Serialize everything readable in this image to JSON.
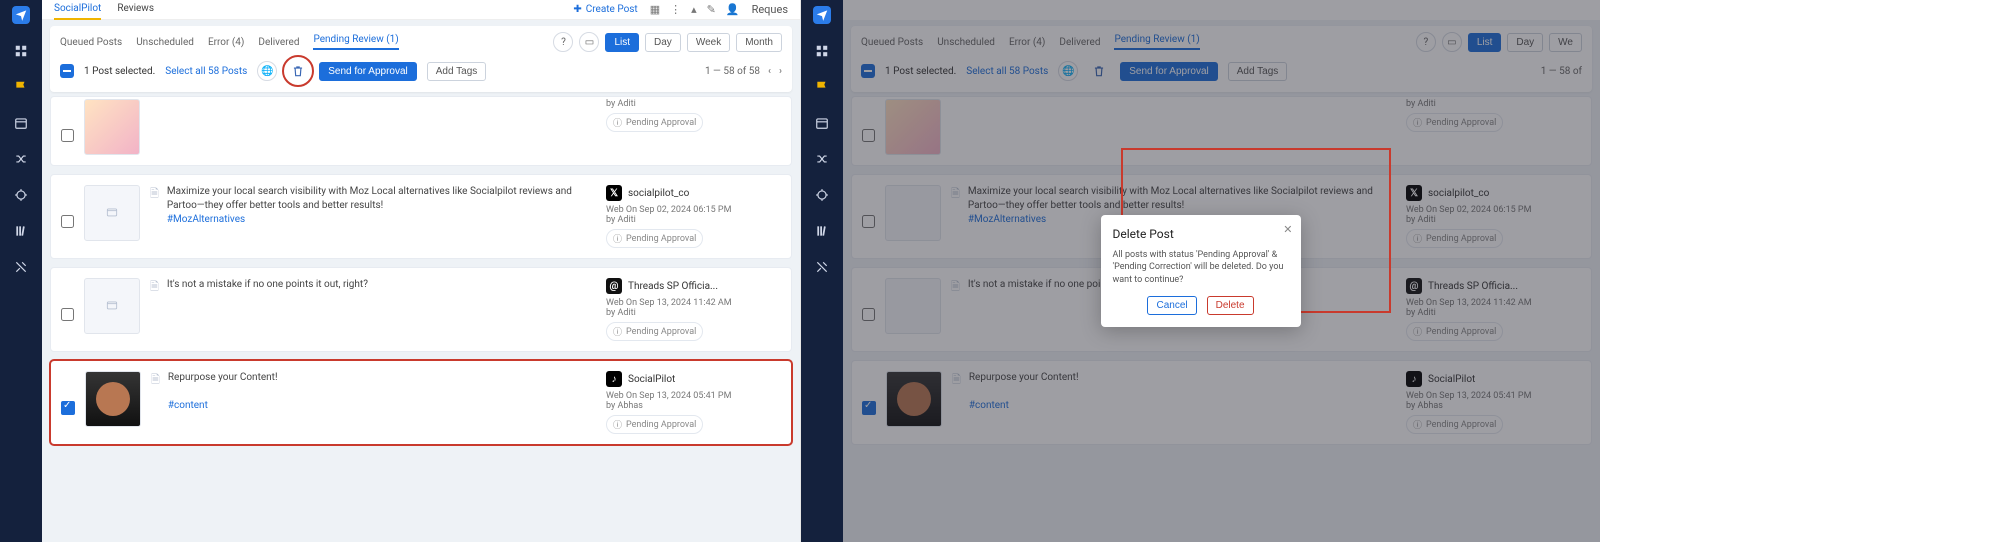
{
  "tabsPrimary": {
    "socialPilot": "SocialPilot",
    "reviews": "Reviews"
  },
  "topbar": {
    "createPost": "Create Post",
    "requests": "Reques"
  },
  "filters": {
    "queued": "Queued Posts",
    "unscheduled": "Unscheduled",
    "error": "Error (4)",
    "delivered": "Delivered",
    "pending": "Pending Review (1)"
  },
  "viewSwitch": {
    "list": "List",
    "day": "Day",
    "week": "Week",
    "month": "Month"
  },
  "actionbar": {
    "selectedText": "1 Post selected.",
    "selectAll": "Select all 58 Posts",
    "sendApproval": "Send for Approval",
    "addTags": "Add Tags",
    "pager": "1 — 58 of 58",
    "pagerShort": "1 — 58 of"
  },
  "posts": {
    "p0": {
      "author": "by Aditi",
      "status": "Pending Approval"
    },
    "p1": {
      "text": "Maximize your local search visibility with Moz Local alternatives like Socialpilot reviews and Partoo—they offer better tools and better results!",
      "hashtag": "#MozAlternatives",
      "acct": "socialpilot_co",
      "time": "Web On Sep 02, 2024 06:15 PM",
      "author": "by Aditi",
      "status": "Pending Approval"
    },
    "p2": {
      "text": "It's not a mistake if no one points it out, right?",
      "textShort": "It's not a mistake if no one points it out,",
      "acct": "Threads SP Officia...",
      "time": "Web On Sep 13, 2024 11:42 AM",
      "author": "by Aditi",
      "status": "Pending Approval"
    },
    "p3": {
      "text": "Repurpose your Content!",
      "hashtag": "#content",
      "acct": "SocialPilot",
      "time": "Web On Sep 13, 2024 05:41 PM",
      "author": "by Abhas",
      "status": "Pending Approval"
    }
  },
  "modal": {
    "title": "Delete Post",
    "body": "All posts with status 'Pending Approval' & 'Pending Correction' will be deleted. Do you want to continue?",
    "cancel": "Cancel",
    "delete": "Delete"
  }
}
